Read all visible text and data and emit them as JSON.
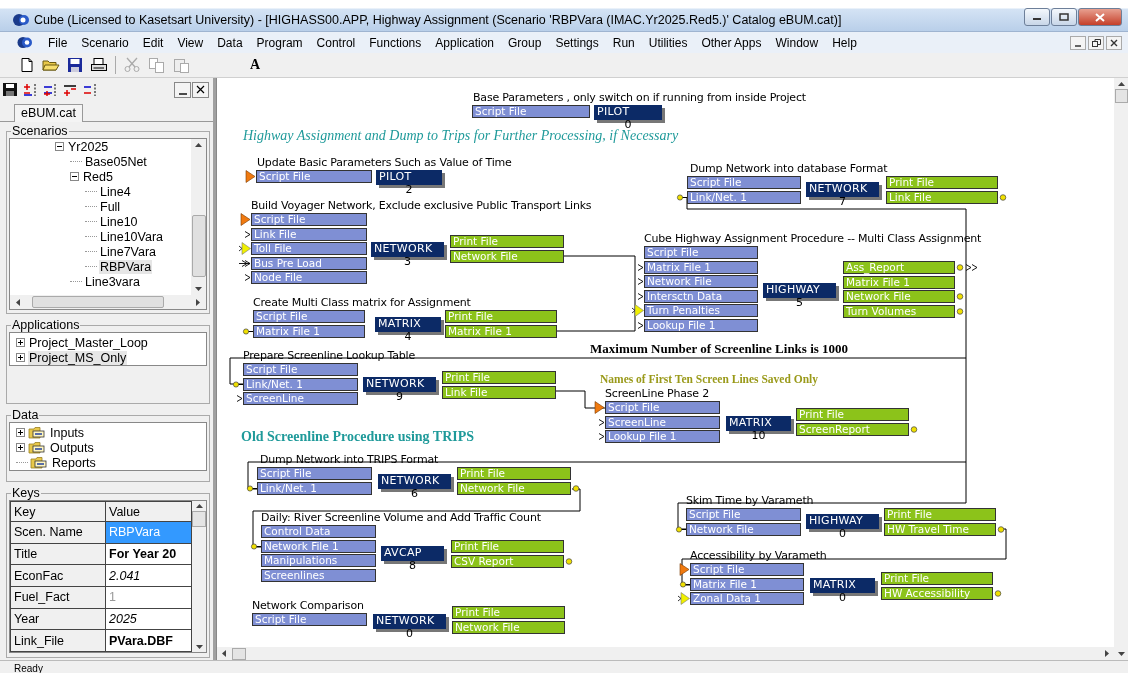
{
  "window": {
    "title": "Cube (Licensed to Kasetsart University) - [HIGHASS00.APP, Highway Assignment (Scenario 'RBPVara (IMAC.Yr2025.Red5.)' Catalog eBUM.cat)]"
  },
  "menu": [
    "File",
    "Scenario",
    "Edit",
    "View",
    "Data",
    "Program",
    "Control",
    "Functions",
    "Application",
    "Group",
    "Settings",
    "Run",
    "Utilities",
    "Other Apps",
    "Window",
    "Help"
  ],
  "toolbar": {
    "text_tool": "A"
  },
  "catalog_tab": {
    "label": "eBUM.cat",
    "selected": true
  },
  "scenarios": {
    "title": "Scenarios",
    "items": [
      {
        "label": "Yr2025",
        "expanded": true,
        "selected": false,
        "children": [
          {
            "label": "Base05Net",
            "selected": false
          },
          {
            "label": "Red5",
            "expanded": true,
            "selected": false,
            "children": [
              {
                "label": "Line4",
                "selected": false
              },
              {
                "label": "Full",
                "selected": false
              },
              {
                "label": "Line10",
                "selected": false
              },
              {
                "label": "Line10Vara",
                "selected": false
              },
              {
                "label": "Line7Vara",
                "selected": false
              },
              {
                "label": "RBPVara",
                "selected": true
              }
            ]
          },
          {
            "label": "Line3vara",
            "selected": false
          }
        ]
      }
    ]
  },
  "applications": {
    "title": "Applications",
    "items": [
      {
        "label": "Project_Master_Loop",
        "expanded": false,
        "selected": false
      },
      {
        "label": "Project_MS_Only",
        "expanded": false,
        "selected": true
      }
    ]
  },
  "data": {
    "title": "Data",
    "items": [
      {
        "label": "Inputs",
        "expanded": false
      },
      {
        "label": "Outputs",
        "expanded": false
      },
      {
        "label": "Reports"
      }
    ]
  },
  "keys": {
    "title": "Keys",
    "columns": [
      "Key",
      "Value"
    ],
    "rows": [
      {
        "key": "Scen. Name",
        "value": "RBPVara",
        "kind": "plain",
        "selected": true
      },
      {
        "key": "Title",
        "value": "For Year 20",
        "kind": "bold",
        "selected": false
      },
      {
        "key": "EconFac",
        "value": "2.041",
        "kind": "italic",
        "selected": false
      },
      {
        "key": "Fuel_Fact",
        "value": "1",
        "kind": "dim",
        "selected": false
      },
      {
        "key": "Year",
        "value": "2025",
        "kind": "italic",
        "selected": false
      },
      {
        "key": "Link_File",
        "value": "PVara.DBF",
        "kind": "bold",
        "selected": false
      }
    ]
  },
  "notes": [
    {
      "text": "Highway Assignment and Dump to Trips for Further Processing, if Necessary",
      "kind": "italic",
      "color": "#1f9a9a"
    },
    {
      "text": "Maximum Number of Screenline Links is 1000",
      "kind": "bold",
      "color": "#000000"
    },
    {
      "text": "Names of First Ten Screen Lines Saved Only",
      "kind": "bold",
      "color": "#9a9a1a"
    },
    {
      "text": "Old Screenline Procedure using TRIPS",
      "kind": "bold",
      "color": "#1f9a9a"
    }
  ],
  "modules": [
    {
      "title": "Base Parameters , only switch on if running from inside Project",
      "program": "PILOT",
      "number": "0",
      "inputs": [
        {
          "label": "Script File",
          "kind": "plain"
        }
      ]
    },
    {
      "title": "Update Basic Parameters Such as Value of Time",
      "program": "PILOT",
      "number": "2",
      "inputs": [
        {
          "label": "Script File",
          "kind": "orange-triangle"
        }
      ]
    },
    {
      "title": "Build Voyager Network, Exclude exclusive Public Transport Links",
      "program": "NETWORK",
      "number": "3",
      "inputs": [
        {
          "label": "Script File",
          "kind": "orange-triangle"
        },
        {
          "label": "Link File",
          "kind": "chevron"
        },
        {
          "label": "Toll File",
          "kind": "yellow-triangle"
        },
        {
          "label": "Bus Pre Load",
          "kind": "double-chevron"
        },
        {
          "label": "Node File",
          "kind": "chevron"
        }
      ],
      "outputs": [
        {
          "label": "Print File",
          "kind": "plain"
        },
        {
          "label": "Network File",
          "kind": "plain"
        }
      ]
    },
    {
      "title": "Create Multi Class matrix for Assignment",
      "program": "MATRIX",
      "number": "4",
      "inputs": [
        {
          "label": "Script File",
          "kind": "plain"
        },
        {
          "label": "Matrix File 1",
          "kind": "link-dot"
        }
      ],
      "outputs": [
        {
          "label": "Print File",
          "kind": "plain"
        },
        {
          "label": "Matrix File 1",
          "kind": "plain"
        }
      ]
    },
    {
      "title": "Prepare Screenline Lookup Table",
      "program": "NETWORK",
      "number": "9",
      "inputs": [
        {
          "label": "Script File",
          "kind": "plain"
        },
        {
          "label": "Link/Net. 1",
          "kind": "link-dot"
        },
        {
          "label": "ScreenLine",
          "kind": "chevron"
        }
      ],
      "outputs": [
        {
          "label": "Print File",
          "kind": "plain"
        },
        {
          "label": "Link File",
          "kind": "plain"
        }
      ]
    },
    {
      "title": "Dump Network into database Format",
      "program": "NETWORK",
      "number": "7",
      "inputs": [
        {
          "label": "Script File",
          "kind": "plain"
        },
        {
          "label": "Link/Net. 1",
          "kind": "link-dot"
        }
      ],
      "outputs": [
        {
          "label": "Print File",
          "kind": "plain"
        },
        {
          "label": "Link File",
          "kind": "dot"
        }
      ]
    },
    {
      "title": "Cube Highway Assignment Procedure -- Multi Class Assignment",
      "program": "HIGHWAY",
      "number": "5",
      "inputs": [
        {
          "label": "Script File",
          "kind": "plain"
        },
        {
          "label": "Matrix File 1",
          "kind": "chevron"
        },
        {
          "label": "Network File",
          "kind": "chevron"
        },
        {
          "label": "Intersctn Data",
          "kind": "chevron"
        },
        {
          "label": "Turn Penalties",
          "kind": "yellow-triangle"
        },
        {
          "label": "Lookup File 1",
          "kind": "chevron"
        }
      ],
      "outputs": [
        {
          "label": "Ass_Report",
          "kind": "dot-chevron"
        },
        {
          "label": "Matrix File 1",
          "kind": "plain"
        },
        {
          "label": "Network File",
          "kind": "dot"
        },
        {
          "label": "Turn Volumes",
          "kind": "dot"
        }
      ]
    },
    {
      "title": "ScreenLine Phase 2",
      "program": "MATRIX",
      "number": "10",
      "inputs": [
        {
          "label": "Script File",
          "kind": "orange-triangle"
        },
        {
          "label": "ScreenLine",
          "kind": "chevron"
        },
        {
          "label": "Lookup File 1",
          "kind": "chevron"
        }
      ],
      "outputs": [
        {
          "label": "Print File",
          "kind": "plain"
        },
        {
          "label": "ScreenReport",
          "kind": "dot"
        }
      ]
    },
    {
      "title": "Dump Network into TRIPS Format",
      "program": "NETWORK",
      "number": "6",
      "inputs": [
        {
          "label": "Script File",
          "kind": "plain"
        },
        {
          "label": "Link/Net. 1",
          "kind": "link-dot"
        }
      ],
      "outputs": [
        {
          "label": "Print File",
          "kind": "plain"
        },
        {
          "label": "Network File",
          "kind": "dot"
        }
      ]
    },
    {
      "title": "Daily:  River Screenline Volume and Add Traffic Count",
      "program": "AVCAP",
      "number": "8",
      "inputs": [
        {
          "label": "Control Data",
          "kind": "plain"
        },
        {
          "label": "Network File 1",
          "kind": "link-dot"
        },
        {
          "label": "Manipulations",
          "kind": "plain"
        },
        {
          "label": "Screenlines",
          "kind": "plain"
        }
      ],
      "outputs": [
        {
          "label": "Print File",
          "kind": "plain"
        },
        {
          "label": "CSV Report",
          "kind": "dot"
        }
      ]
    },
    {
      "title": "Network Comparison",
      "program": "NETWORK",
      "number": "0",
      "inputs": [
        {
          "label": "Script File",
          "kind": "plain"
        }
      ],
      "outputs": [
        {
          "label": "Print File",
          "kind": "plain"
        },
        {
          "label": "Network File",
          "kind": "plain"
        }
      ]
    },
    {
      "title": "Skim Time by Varameth",
      "program": "HIGHWAY",
      "number": "0",
      "inputs": [
        {
          "label": "Script File",
          "kind": "plain"
        },
        {
          "label": "Network File",
          "kind": "link-dot"
        }
      ],
      "outputs": [
        {
          "label": "Print File",
          "kind": "plain"
        },
        {
          "label": "HW Travel Time",
          "kind": "dot"
        }
      ]
    },
    {
      "title": "Accessibility by Varameth",
      "program": "MATRIX",
      "number": "0",
      "inputs": [
        {
          "label": "Script File",
          "kind": "orange-triangle"
        },
        {
          "label": "Matrix File 1",
          "kind": "link-dot"
        },
        {
          "label": "Zonal Data 1",
          "kind": "yellow-triangle"
        }
      ],
      "outputs": [
        {
          "label": "Print File",
          "kind": "plain"
        },
        {
          "label": "HW Accessibility",
          "kind": "dot"
        }
      ]
    }
  ],
  "status_bar": {
    "text": "Ready"
  }
}
